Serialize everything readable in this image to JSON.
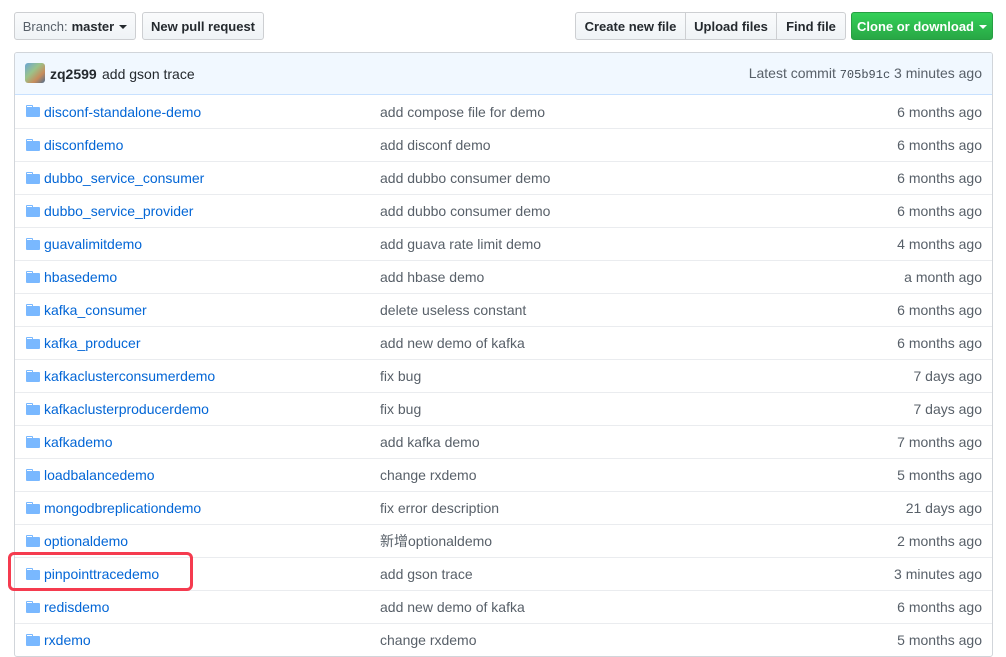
{
  "toolbar": {
    "branch_prefix": "Branch:",
    "branch_name": "master",
    "new_pull_request": "New pull request",
    "create_new_file": "Create new file",
    "upload_files": "Upload files",
    "find_file": "Find file",
    "clone_or_download": "Clone or download"
  },
  "commit": {
    "author": "zq2599",
    "message": "add gson trace",
    "latest_label": "Latest commit",
    "sha": "705b91c",
    "age": "3 minutes ago"
  },
  "files": [
    {
      "name": "disconf-standalone-demo",
      "message": "add compose file for demo",
      "age": "6 months ago"
    },
    {
      "name": "disconfdemo",
      "message": "add disconf demo",
      "age": "6 months ago"
    },
    {
      "name": "dubbo_service_consumer",
      "message": "add dubbo consumer demo",
      "age": "6 months ago"
    },
    {
      "name": "dubbo_service_provider",
      "message": "add dubbo consumer demo",
      "age": "6 months ago"
    },
    {
      "name": "guavalimitdemo",
      "message": "add guava rate limit demo",
      "age": "4 months ago"
    },
    {
      "name": "hbasedemo",
      "message": "add hbase demo",
      "age": "a month ago"
    },
    {
      "name": "kafka_consumer",
      "message": "delete useless constant",
      "age": "6 months ago"
    },
    {
      "name": "kafka_producer",
      "message": "add new demo of kafka",
      "age": "6 months ago"
    },
    {
      "name": "kafkaclusterconsumerdemo",
      "message": "fix bug",
      "age": "7 days ago"
    },
    {
      "name": "kafkaclusterproducerdemo",
      "message": "fix bug",
      "age": "7 days ago"
    },
    {
      "name": "kafkademo",
      "message": "add kafka demo",
      "age": "7 months ago"
    },
    {
      "name": "loadbalancedemo",
      "message": "change rxdemo",
      "age": "5 months ago"
    },
    {
      "name": "mongodbreplicationdemo",
      "message": "fix error description",
      "age": "21 days ago"
    },
    {
      "name": "optionaldemo",
      "message": "新增optionaldemo",
      "age": "2 months ago"
    },
    {
      "name": "pinpointtracedemo",
      "message": "add gson trace",
      "age": "3 minutes ago"
    },
    {
      "name": "redisdemo",
      "message": "add new demo of kafka",
      "age": "6 months ago"
    },
    {
      "name": "rxdemo",
      "message": "change rxdemo",
      "age": "5 months ago"
    }
  ],
  "icons": {
    "folder": "folder-icon",
    "caret": "caret-down-icon"
  },
  "colors": {
    "link": "#0366d6",
    "folder": "#79b8ff",
    "clone_button": "#28a745",
    "highlight": "#f53b4f"
  }
}
